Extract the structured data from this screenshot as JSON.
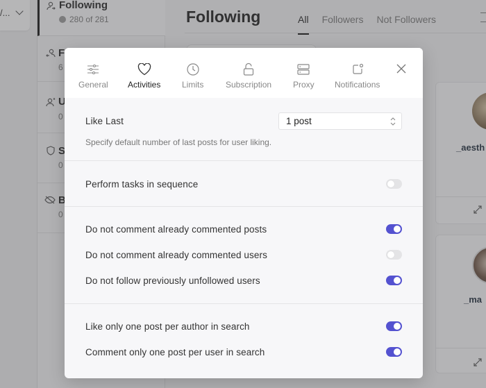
{
  "background": {
    "dropdown_truncated": "/...",
    "nav": [
      {
        "title": "Following",
        "sub": "280 of 281",
        "icon": "user-follow-icon",
        "active": true
      },
      {
        "title": "F",
        "sub": "6",
        "icon": "user-follower-icon",
        "active": false
      },
      {
        "title": "U",
        "sub": "0",
        "icon": "user-unfollow-icon",
        "active": false
      },
      {
        "title": "S",
        "sub": "0",
        "icon": "shield-icon",
        "active": false
      },
      {
        "title": "B",
        "sub": "0",
        "icon": "eye-off-icon",
        "active": false
      }
    ],
    "main_title": "Following",
    "tabs": [
      {
        "label": "All",
        "active": true
      },
      {
        "label": "Followers",
        "active": false
      },
      {
        "label": "Not Followers",
        "active": false
      }
    ],
    "cards": [
      {
        "username": "_aesth"
      },
      {
        "username": "_ma"
      }
    ]
  },
  "modal": {
    "tabs": [
      {
        "label": "General",
        "icon": "sliders-icon",
        "active": false
      },
      {
        "label": "Activities",
        "icon": "heart-icon",
        "active": true
      },
      {
        "label": "Limits",
        "icon": "clock-icon",
        "active": false
      },
      {
        "label": "Subscription",
        "icon": "unlock-icon",
        "active": false
      },
      {
        "label": "Proxy",
        "icon": "server-icon",
        "active": false
      },
      {
        "label": "Notifications",
        "icon": "notification-icon",
        "active": false
      }
    ],
    "like_last": {
      "label": "Like Last",
      "value": "1 post",
      "hint": "Specify default number of last posts for user liking."
    },
    "sequence": {
      "label": "Perform tasks in sequence",
      "on": false
    },
    "comment_follow": [
      {
        "label": "Do not comment already commented posts",
        "on": true
      },
      {
        "label": "Do not comment already commented users",
        "on": false
      },
      {
        "label": "Do not follow previously unfollowed users",
        "on": true
      }
    ],
    "search": [
      {
        "label": "Like only one post per author in search",
        "on": true
      },
      {
        "label": "Comment only one post per user in search",
        "on": true
      }
    ],
    "colors": {
      "toggle_on": "#5452d0",
      "toggle_off": "#e4e4e6"
    }
  }
}
